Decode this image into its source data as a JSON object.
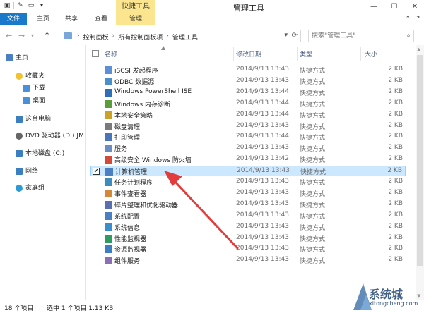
{
  "window": {
    "title": "管理工具",
    "context_tab_group": "快捷工具",
    "controls": [
      "—",
      "☐",
      "✕"
    ]
  },
  "ribbon": {
    "tabs": [
      "文件",
      "主页",
      "共享",
      "查看",
      "管理"
    ],
    "right": [
      "⌃",
      "?"
    ]
  },
  "address": {
    "crumbs": [
      "控制面板",
      "所有控制面板项",
      "管理工具"
    ],
    "search_placeholder": "搜索\"管理工具\""
  },
  "nav": {
    "items": [
      {
        "label": "主页",
        "icon": "home-icon",
        "color": "#4a7fc1"
      },
      {
        "label": "收藏夹",
        "icon": "star-icon",
        "color": "#f2c230"
      },
      {
        "label": "下载",
        "icon": "download-folder-icon",
        "color": "#4a90d9"
      },
      {
        "label": "桌面",
        "icon": "desktop-folder-icon",
        "color": "#4a90d9"
      },
      {
        "label": "这台电脑",
        "icon": "computer-icon",
        "color": "#3c7fc0"
      },
      {
        "label": "DVD 驱动器 (D:) JM",
        "icon": "dvd-drive-icon",
        "color": "#666666"
      },
      {
        "label": "本地磁盘 (C:)",
        "icon": "disk-icon",
        "color": "#3c7fc0"
      },
      {
        "label": "网络",
        "icon": "network-icon",
        "color": "#3c7fc0"
      },
      {
        "label": "家庭组",
        "icon": "homegroup-icon",
        "color": "#2b9ad6"
      }
    ]
  },
  "columns": {
    "name": "名称",
    "date": "修改日期",
    "type": "类型",
    "size": "大小"
  },
  "files": [
    {
      "name": "iSCSI 发起程序",
      "date": "2014/9/13 13:43",
      "type": "快捷方式",
      "size": "2 KB",
      "selected": false
    },
    {
      "name": "ODBC 数据源",
      "date": "2014/9/13 13:43",
      "type": "快捷方式",
      "size": "2 KB",
      "selected": false
    },
    {
      "name": "Windows PowerShell ISE",
      "date": "2014/9/13 13:44",
      "type": "快捷方式",
      "size": "2 KB",
      "selected": false
    },
    {
      "name": "Windows 内存诊断",
      "date": "2014/9/13 13:44",
      "type": "快捷方式",
      "size": "2 KB",
      "selected": false
    },
    {
      "name": "本地安全策略",
      "date": "2014/9/13 13:44",
      "type": "快捷方式",
      "size": "2 KB",
      "selected": false
    },
    {
      "name": "磁盘清理",
      "date": "2014/9/13 13:43",
      "type": "快捷方式",
      "size": "2 KB",
      "selected": false
    },
    {
      "name": "打印管理",
      "date": "2014/9/13 13:44",
      "type": "快捷方式",
      "size": "2 KB",
      "selected": false
    },
    {
      "name": "服务",
      "date": "2014/9/13 13:43",
      "type": "快捷方式",
      "size": "2 KB",
      "selected": false
    },
    {
      "name": "高级安全 Windows 防火墙",
      "date": "2014/9/13 13:42",
      "type": "快捷方式",
      "size": "2 KB",
      "selected": false
    },
    {
      "name": "计算机管理",
      "date": "2014/9/13 13:43",
      "type": "快捷方式",
      "size": "2 KB",
      "selected": true
    },
    {
      "name": "任务计划程序",
      "date": "2014/9/13 13:43",
      "type": "快捷方式",
      "size": "2 KB",
      "selected": false
    },
    {
      "name": "事件查看器",
      "date": "2014/9/13 13:43",
      "type": "快捷方式",
      "size": "2 KB",
      "selected": false
    },
    {
      "name": "碎片整理和优化驱动器",
      "date": "2014/9/13 13:43",
      "type": "快捷方式",
      "size": "2 KB",
      "selected": false
    },
    {
      "name": "系统配置",
      "date": "2014/9/13 13:43",
      "type": "快捷方式",
      "size": "2 KB",
      "selected": false
    },
    {
      "name": "系统信息",
      "date": "2014/9/13 13:43",
      "type": "快捷方式",
      "size": "2 KB",
      "selected": false
    },
    {
      "name": "性能监视器",
      "date": "2014/9/13 13:43",
      "type": "快捷方式",
      "size": "2 KB",
      "selected": false
    },
    {
      "name": "资源监视器",
      "date": "2014/9/13 13:43",
      "type": "快捷方式",
      "size": "2 KB",
      "selected": false
    },
    {
      "name": "组件服务",
      "date": "2014/9/13 13:43",
      "type": "快捷方式",
      "size": "2 KB",
      "selected": false
    }
  ],
  "status": {
    "count": "18 个项目",
    "selection": "选中 1 个项目  1.13 KB"
  },
  "watermark": {
    "brand": "系统城",
    "url": "xitongcheng.com"
  },
  "colors": {
    "accent": "#1979ca",
    "context_tab": "#fbe68f",
    "selection_bg": "#cce8ff",
    "annotation_arrow": "#e23c3c"
  }
}
